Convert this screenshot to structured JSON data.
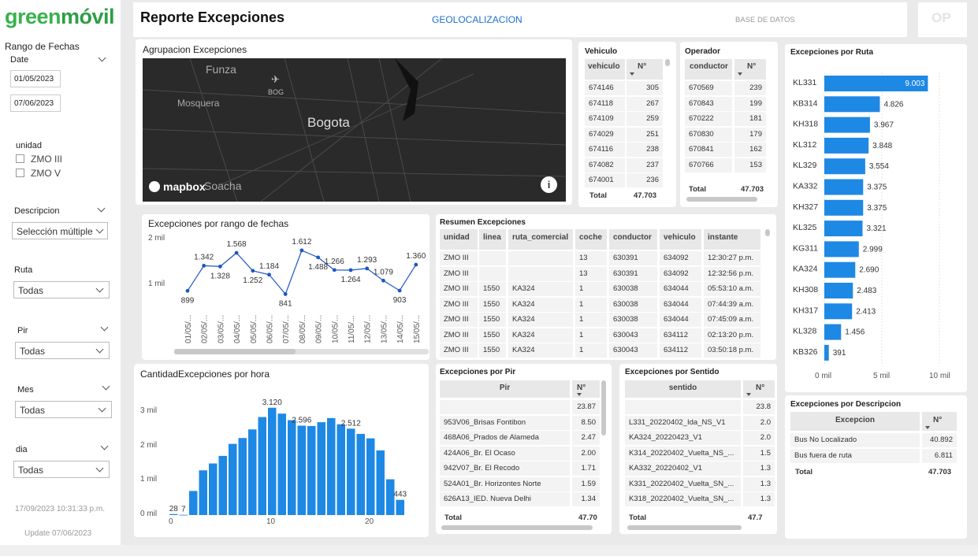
{
  "brand": {
    "logo": "greenmóvil",
    "op_badge": "OP"
  },
  "header": {
    "title": "Reporte Excepciones",
    "nav_geo": "GEOLOCALIZACION",
    "nav_db": "BASE DE DATOS"
  },
  "sidebar": {
    "range_title": "Rango de Fechas",
    "date_label": "Date",
    "date_from": "01/05/2023",
    "date_to": "07/06/2023",
    "unidad_label": "unidad",
    "unidad_options": [
      "ZMO III",
      "ZMO V"
    ],
    "descripcion_label": "Descripcion",
    "descripcion_value": "Selección múltiple",
    "ruta_label": "Ruta",
    "ruta_value": "Todas",
    "pir_label": "Pir",
    "pir_value": "Todas",
    "mes_label": "Mes",
    "mes_value": "Todas",
    "dia_label": "dia",
    "dia_value": "Todas",
    "timestamp": "17/09/2023 10:31:33 p.m.",
    "update": "Update 07/06/2023"
  },
  "map": {
    "title": "Agrupacion Excepciones",
    "labels": [
      "Funza",
      "Mosquera",
      "Bogota",
      "Soacha",
      "BOG"
    ],
    "attribution": "mapbox"
  },
  "vehiculo_table": {
    "title": "Vehiculo",
    "headers": [
      "vehiculo",
      "N°"
    ],
    "rows": [
      [
        "674146",
        "305"
      ],
      [
        "674118",
        "267"
      ],
      [
        "674109",
        "259"
      ],
      [
        "674029",
        "251"
      ],
      [
        "674116",
        "238"
      ],
      [
        "674082",
        "237"
      ],
      [
        "674001",
        "236"
      ]
    ],
    "total_label": "Total",
    "total": "47.703"
  },
  "operador_table": {
    "title": "Operador",
    "headers": [
      "conductor",
      "N°"
    ],
    "rows": [
      [
        "670569",
        "239"
      ],
      [
        "670843",
        "199"
      ],
      [
        "670222",
        "181"
      ],
      [
        "670830",
        "179"
      ],
      [
        "670841",
        "162"
      ],
      [
        "670766",
        "153"
      ]
    ],
    "total_label": "Total",
    "total": "47.703"
  },
  "ruta_chart": {
    "title": "Excepciones por Ruta",
    "x_ticks": [
      "0 mil",
      "5 mil",
      "10 mil"
    ]
  },
  "rango_chart": {
    "title": "Excepciones por rango de fechas",
    "y_ticks": [
      "2 mil",
      "1 mil"
    ],
    "labels": [
      "1.342",
      "1.328",
      "1.568",
      "1.252",
      "1.184",
      "841",
      "1.612",
      "1.488",
      "1.266",
      "1.264",
      "1.293",
      "1.079",
      "903",
      "1.360",
      "899"
    ]
  },
  "resumen": {
    "title": "Resumen Excepciones",
    "headers": [
      "unidad",
      "linea",
      "ruta_comercial",
      "coche",
      "conductor",
      "vehiculo",
      "instante"
    ],
    "rows": [
      [
        "ZMO III",
        "",
        "",
        "13",
        "630391",
        "634092",
        "12:30:27 p.m."
      ],
      [
        "ZMO III",
        "",
        "",
        "13",
        "630391",
        "634092",
        "12:32:56 p.m."
      ],
      [
        "ZMO III",
        "1550",
        "KA324",
        "1",
        "630038",
        "634044",
        "05:53:10 a.m."
      ],
      [
        "ZMO III",
        "1550",
        "KA324",
        "1",
        "630038",
        "634044",
        "07:44:39 a.m."
      ],
      [
        "ZMO III",
        "1550",
        "KA324",
        "1",
        "630038",
        "634044",
        "07:45:09 a.m."
      ],
      [
        "ZMO III",
        "1550",
        "KA324",
        "1",
        "630043",
        "634112",
        "02:13:20 p.m."
      ],
      [
        "ZMO III",
        "1550",
        "KA324",
        "1",
        "630043",
        "634112",
        "03:50:18 p.m."
      ]
    ]
  },
  "hora_chart": {
    "title": "CantidadExcepciones por hora",
    "y_ticks": [
      "3 mil",
      "2 mil",
      "1 mil",
      "0 mil"
    ],
    "x_ticks": [
      "0",
      "10",
      "20"
    ]
  },
  "pir_table": {
    "title": "Excepciones por Pir",
    "headers": [
      "Pir",
      "N°"
    ],
    "rows": [
      [
        "",
        "23.87"
      ],
      [
        "953V06_Brisas Fontibon",
        "8.50"
      ],
      [
        "468A06_Prados de Alameda",
        "2.47"
      ],
      [
        "424A06_Br. El Ocaso",
        "2.00"
      ],
      [
        "942V07_Br. El Recodo",
        "1.71"
      ],
      [
        "524A01_Br. Horizontes Norte",
        "1.59"
      ],
      [
        "626A13_IED. Nueva Delhi",
        "1.34"
      ]
    ],
    "total_label": "Total",
    "total": "47.70"
  },
  "sentido_table": {
    "title": "Excepciones por Sentido",
    "headers": [
      "sentido",
      "N°"
    ],
    "rows": [
      [
        "",
        "23.8"
      ],
      [
        "L331_20220402_Ida_NS_V1",
        "2.0"
      ],
      [
        "KA324_20220423_V1",
        "2.0"
      ],
      [
        "K314_20220402_Vuelta_NS_...",
        "1.5"
      ],
      [
        "KA332_20220402_V1",
        "1.3"
      ],
      [
        "K331_20220402_Vuelta_SN_...",
        "1.3"
      ],
      [
        "K318_20220402_Vuelta_SN_...",
        "1.3"
      ]
    ],
    "total_label": "Total",
    "total": "47.7"
  },
  "descripcion_table": {
    "title": "Excepciones por Descripcion",
    "headers": [
      "Excepcion",
      "N°"
    ],
    "rows": [
      [
        "Bus No Localizado",
        "40.892"
      ],
      [
        "Bus fuera de ruta",
        "6.811"
      ]
    ],
    "total_label": "Total",
    "total": "47.703"
  },
  "chart_data": [
    {
      "type": "bar",
      "title": "Excepciones por Ruta",
      "categories": [
        "KL331",
        "KB314",
        "KH318",
        "KL312",
        "KL329",
        "KA332",
        "KH327",
        "KL325",
        "KG311",
        "KA324",
        "KH308",
        "KH317",
        "KL328",
        "KB326"
      ],
      "values": [
        9003,
        4826,
        3967,
        3848,
        3554,
        3375,
        3375,
        3321,
        2999,
        2690,
        2483,
        2413,
        1456,
        391
      ],
      "value_labels": [
        "9.003",
        "4.826",
        "3.967",
        "3.848",
        "3.554",
        "3.375",
        "3.375",
        "3.321",
        "2.999",
        "2.690",
        "2.483",
        "2.413",
        "1.456",
        "391"
      ],
      "orientation": "horizontal",
      "xlim": [
        0,
        11000
      ],
      "color": "#1e88e5"
    },
    {
      "type": "line",
      "title": "Excepciones por rango de fechas",
      "categories": [
        "01/05/...",
        "02/05/...",
        "03/05/...",
        "04/05/...",
        "05/05/...",
        "06/05/...",
        "07/05/...",
        "08/05/...",
        "09/05/...",
        "10/05/...",
        "11/05/...",
        "12/05/...",
        "13/05/...",
        "14/05/...",
        "15/05/..."
      ],
      "values": [
        899,
        1342,
        1328,
        1568,
        1252,
        1184,
        841,
        1612,
        1488,
        1266,
        1264,
        1293,
        1079,
        903,
        1360
      ],
      "ylim": [
        0,
        2000
      ],
      "color": "#1a56c4"
    },
    {
      "type": "bar",
      "title": "CantidadExcepciones por hora",
      "x": [
        0,
        1,
        2,
        3,
        4,
        5,
        6,
        7,
        8,
        9,
        10,
        11,
        12,
        13,
        14,
        15,
        16,
        17,
        18,
        19,
        20,
        21,
        22,
        23
      ],
      "values": [
        28,
        7,
        700,
        1300,
        1500,
        1720,
        2070,
        2240,
        2490,
        2850,
        3120,
        2950,
        2760,
        2600,
        2590,
        2700,
        2820,
        2640,
        2512,
        2360,
        2230,
        1880,
        1040,
        443
      ],
      "ylim": [
        0,
        3500
      ],
      "color": "#1e88e5"
    }
  ]
}
